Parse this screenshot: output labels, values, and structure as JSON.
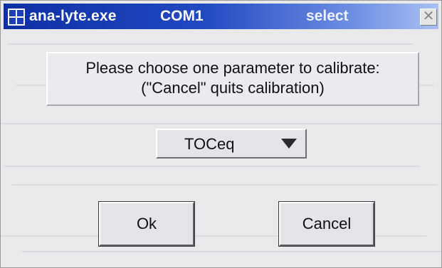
{
  "window": {
    "app_name": "ana-lyte.exe",
    "port": "COM1",
    "mode": "select",
    "close_glyph": "✕"
  },
  "message": {
    "line1": "Please choose one parameter to calibrate:",
    "line2": "(\"Cancel\" quits calibration)"
  },
  "parameter_select": {
    "selected": "TOCeq"
  },
  "buttons": {
    "ok_label": "Ok",
    "cancel_label": "Cancel"
  },
  "colors": {
    "titlebar_start": "#0e2fa3",
    "titlebar_end": "#a9c0f2",
    "dialog_bg": "#e9e9ea"
  },
  "icons": {
    "app": "windows-app-icon",
    "close": "close-icon",
    "dropdown": "triangle-down-icon"
  }
}
